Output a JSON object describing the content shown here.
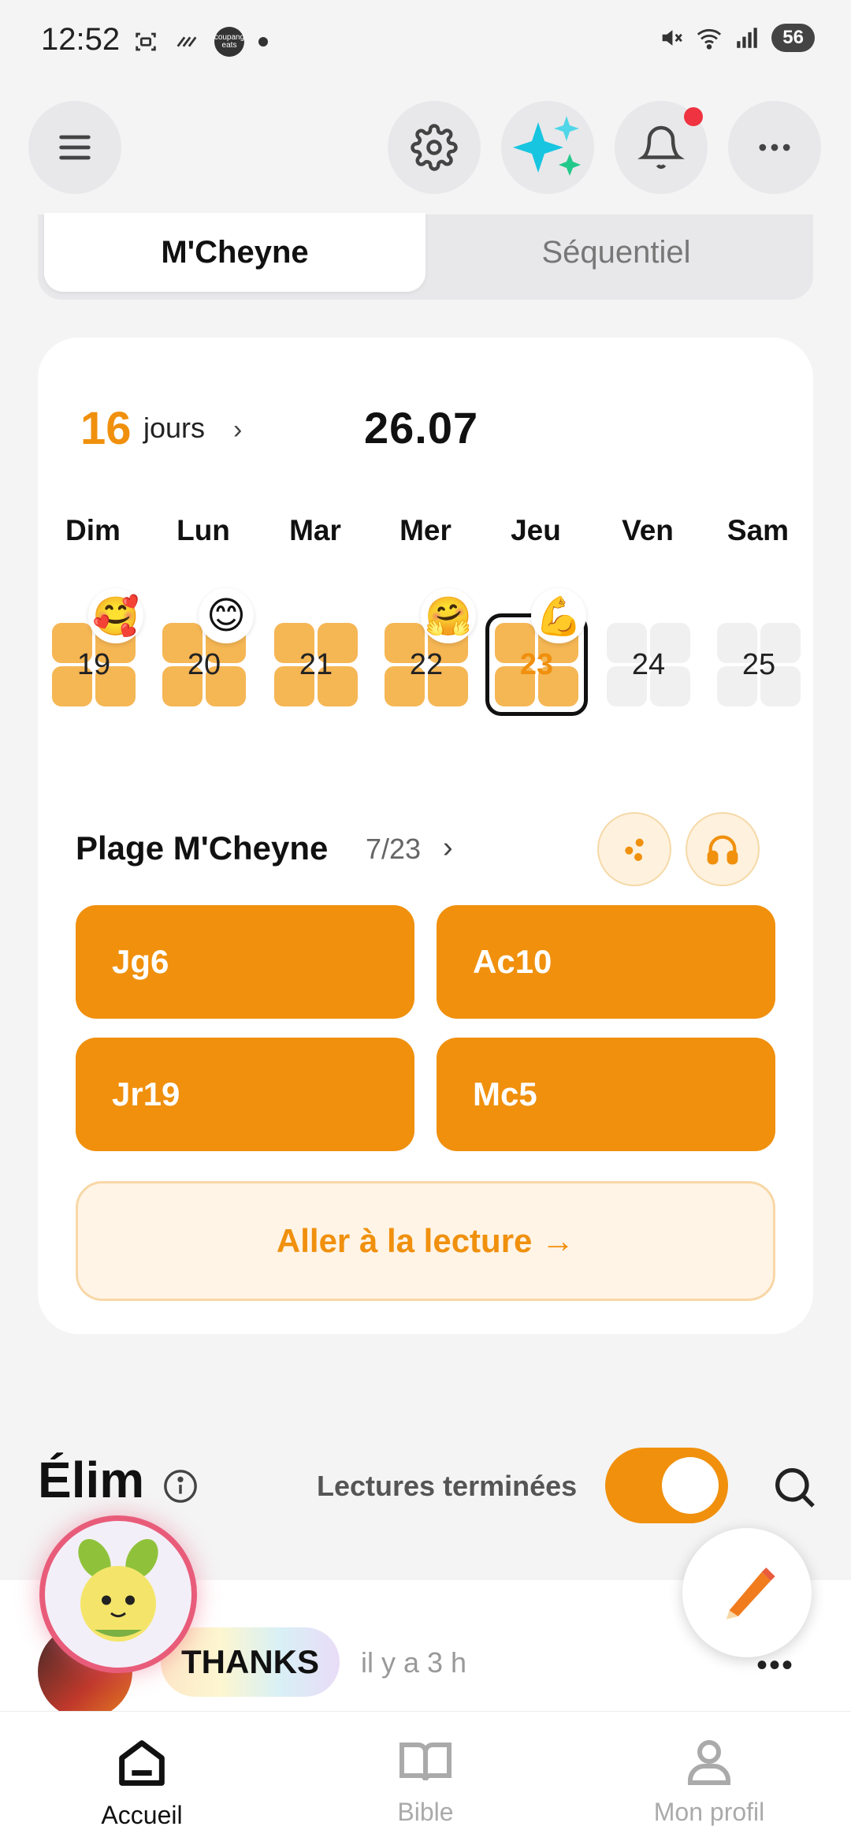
{
  "status_bar": {
    "time": "12:52",
    "battery": "56",
    "coupang_label": "coupang eats"
  },
  "toolbar": {
    "menu_icon": "hamburger-icon",
    "settings_icon": "gear-icon",
    "ai_icon": "sparkle-icon",
    "notification_icon": "bell-icon",
    "more_icon": "more-horizontal-icon"
  },
  "plan_tabs": {
    "active": "M'Cheyne",
    "inactive": "Séquentiel"
  },
  "streak": {
    "count": "16",
    "label": "jours",
    "date": "26.07"
  },
  "week": {
    "days": [
      "Dim",
      "Lun",
      "Mar",
      "Mer",
      "Jeu",
      "Ven",
      "Sam"
    ],
    "dates": [
      "19",
      "20",
      "21",
      "22",
      "23",
      "24",
      "25"
    ],
    "emojis": [
      "🥰",
      "😊",
      "",
      "🤗",
      "💪",
      "",
      ""
    ],
    "completed": [
      true,
      true,
      true,
      true,
      true,
      false,
      false
    ],
    "today_index": 4
  },
  "reading_plan": {
    "title": "Plage M'Cheyne",
    "progress": "7/23",
    "passages": [
      "Jg6",
      "Ac10",
      "Jr19",
      "Mc5"
    ],
    "go_button": "Aller à la lecture →"
  },
  "community": {
    "title": "Élim",
    "finished_label": "Lectures terminées",
    "toggle_on": true
  },
  "feed": {
    "badge": "THANKS",
    "time_ago": "il y a 3 h"
  },
  "bottom_nav": {
    "home": "Accueil",
    "bible": "Bible",
    "profile": "Mon profil"
  },
  "colors": {
    "accent": "#f0900d",
    "accent_light": "#f5b654",
    "notification": "#ef3340"
  }
}
